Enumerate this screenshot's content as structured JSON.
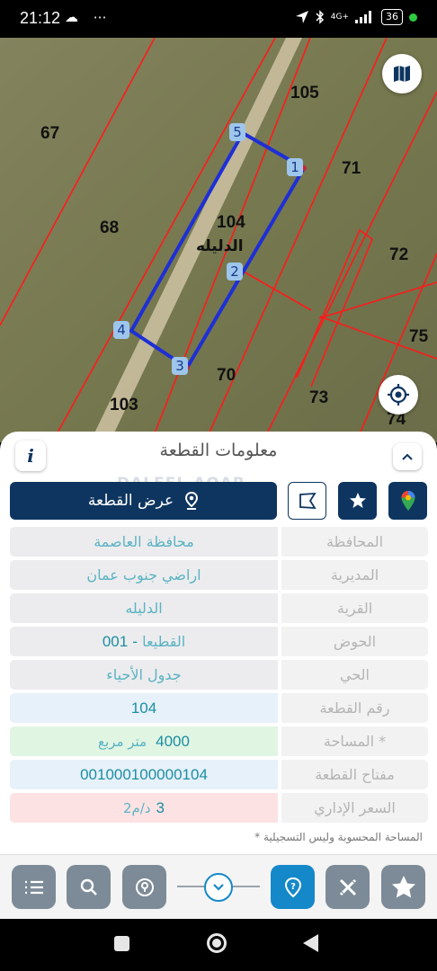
{
  "status_bar": {
    "time": "21:12",
    "left_icons": "☁ ⋯",
    "network": "4G+",
    "battery": "36"
  },
  "map": {
    "parcels": {
      "p105": "105",
      "p67": "67",
      "p71": "71",
      "p68": "68",
      "p104": "104",
      "p72": "72",
      "p75": "75",
      "p70": "70",
      "p73": "73",
      "p103": "103",
      "p74": "74"
    },
    "village_label": "الدليله",
    "vertices": {
      "v1": "1",
      "v2": "2",
      "v3": "3",
      "v4": "4",
      "v5": "5"
    }
  },
  "sheet": {
    "title": "معلومات القطعة",
    "info_label": "i",
    "watermark": "DALEEL AQAR",
    "show_parcel_label": "عرض القطعة"
  },
  "details": {
    "governorate": {
      "label": "المحافظة",
      "value": "محافظة العاصمة"
    },
    "directorate": {
      "label": "المديرية",
      "value": "اراضي جنوب عمان"
    },
    "village": {
      "label": "القرية",
      "value": "الدليله"
    },
    "basin": {
      "label": "الحوض",
      "name": "القطيعا",
      "separator": " - ",
      "number": "001"
    },
    "neighborhood": {
      "label": "الحي",
      "value": "جدول الأحياء"
    },
    "parcel_number": {
      "label": "رقم القطعة",
      "value": "104"
    },
    "area": {
      "label": "المساحة *",
      "value": "4000",
      "unit": "متر مربع"
    },
    "parcel_key": {
      "label": "مفتاح القطعة",
      "value": "001000100000104"
    },
    "admin_price": {
      "label": "السعر الإداري",
      "value": "3",
      "unit": "د/م2"
    }
  },
  "note": "* المساحة المحسوبة وليس التسجيلية",
  "toolbar": {
    "icons": [
      "list-icon",
      "search-icon",
      "location-pin-icon",
      "chevron-down-icon",
      "help-icon",
      "tools-icon",
      "star-icon"
    ]
  },
  "colors": {
    "primary": "#0e3560",
    "accent_blue": "#1588c9",
    "parcel_outline": "#1e2fd6",
    "boundary_red": "#ff1a1a"
  }
}
